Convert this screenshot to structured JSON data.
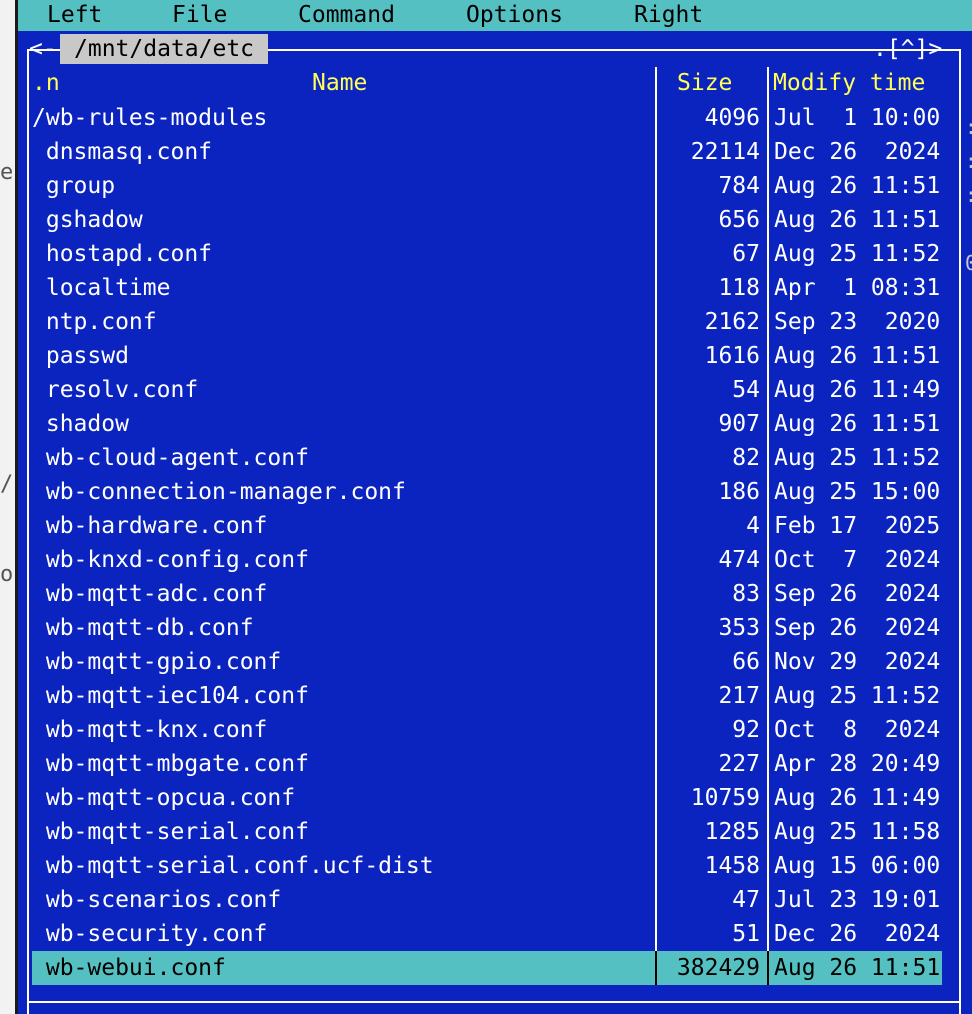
{
  "menu": {
    "items": [
      "Left",
      "File",
      "Command",
      "Options",
      "Right"
    ]
  },
  "panel": {
    "left_corner": "<-",
    "path": "/mnt/data/etc",
    "right_corner": ".[^]>",
    "headers": {
      "sort": ".n",
      "name": "Name",
      "size": "Size",
      "mtime": "Modify time"
    },
    "files": [
      {
        "name": "/wb-rules-modules",
        "size": "4096",
        "mtime": "Jul  1 10:00"
      },
      {
        "name": " dnsmasq.conf",
        "size": "22114",
        "mtime": "Dec 26  2024"
      },
      {
        "name": " group",
        "size": "784",
        "mtime": "Aug 26 11:51"
      },
      {
        "name": " gshadow",
        "size": "656",
        "mtime": "Aug 26 11:51"
      },
      {
        "name": " hostapd.conf",
        "size": "67",
        "mtime": "Aug 25 11:52"
      },
      {
        "name": " localtime",
        "size": "118",
        "mtime": "Apr  1 08:31"
      },
      {
        "name": " ntp.conf",
        "size": "2162",
        "mtime": "Sep 23  2020"
      },
      {
        "name": " passwd",
        "size": "1616",
        "mtime": "Aug 26 11:51"
      },
      {
        "name": " resolv.conf",
        "size": "54",
        "mtime": "Aug 26 11:49"
      },
      {
        "name": " shadow",
        "size": "907",
        "mtime": "Aug 26 11:51"
      },
      {
        "name": " wb-cloud-agent.conf",
        "size": "82",
        "mtime": "Aug 25 11:52"
      },
      {
        "name": " wb-connection-manager.conf",
        "size": "186",
        "mtime": "Aug 25 15:00"
      },
      {
        "name": " wb-hardware.conf",
        "size": "4",
        "mtime": "Feb 17  2025"
      },
      {
        "name": " wb-knxd-config.conf",
        "size": "474",
        "mtime": "Oct  7  2024"
      },
      {
        "name": " wb-mqtt-adc.conf",
        "size": "83",
        "mtime": "Sep 26  2024"
      },
      {
        "name": " wb-mqtt-db.conf",
        "size": "353",
        "mtime": "Sep 26  2024"
      },
      {
        "name": " wb-mqtt-gpio.conf",
        "size": "66",
        "mtime": "Nov 29  2024"
      },
      {
        "name": " wb-mqtt-iec104.conf",
        "size": "217",
        "mtime": "Aug 25 11:52"
      },
      {
        "name": " wb-mqtt-knx.conf",
        "size": "92",
        "mtime": "Oct  8  2024"
      },
      {
        "name": " wb-mqtt-mbgate.conf",
        "size": "227",
        "mtime": "Apr 28 20:49"
      },
      {
        "name": " wb-mqtt-opcua.conf",
        "size": "10759",
        "mtime": "Aug 26 11:49"
      },
      {
        "name": " wb-mqtt-serial.conf",
        "size": "1285",
        "mtime": "Aug 25 11:58"
      },
      {
        "name": " wb-mqtt-serial.conf.ucf-dist",
        "size": "1458",
        "mtime": "Aug 15 06:00"
      },
      {
        "name": " wb-scenarios.conf",
        "size": "47",
        "mtime": "Jul 23 19:01"
      },
      {
        "name": " wb-security.conf",
        "size": "51",
        "mtime": "Dec 26  2024"
      },
      {
        "name": " wb-webui.conf",
        "size": "382429",
        "mtime": "Aug 26 11:51",
        "selected": true
      }
    ]
  },
  "colors": {
    "panel_bg": "#0b24c0",
    "header_text": "#ffff55",
    "selection_bg": "#55c0c2",
    "menubar_bg": "#55c0c2",
    "path_title_bg": "#c8c8c8"
  }
}
